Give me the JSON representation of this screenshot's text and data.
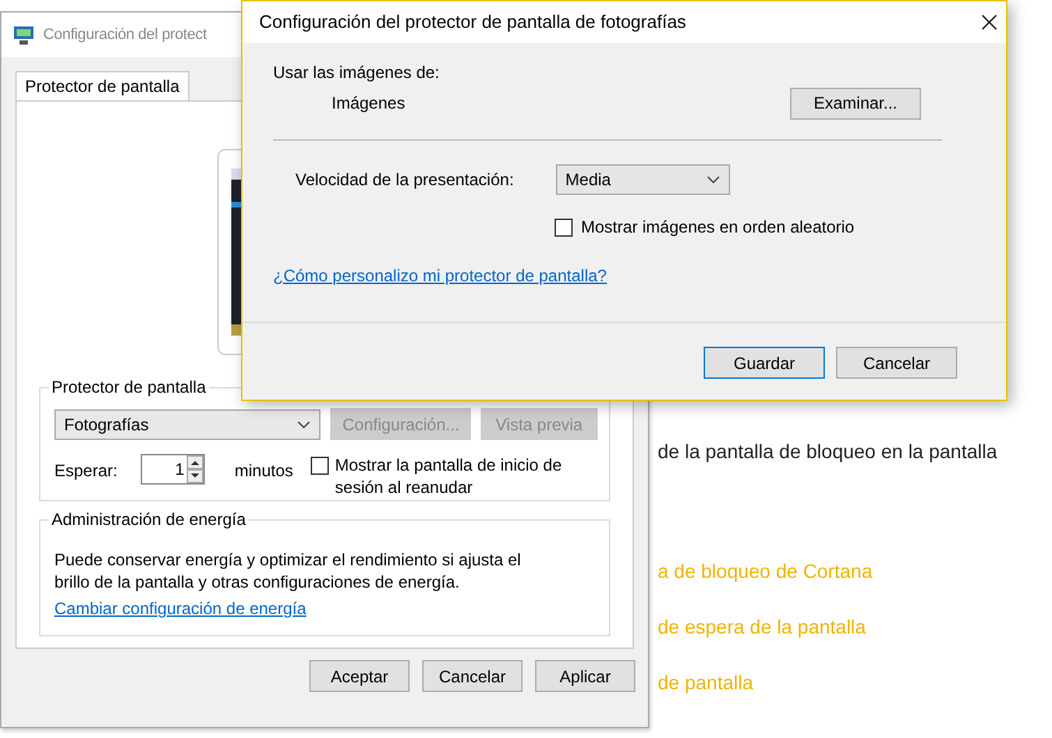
{
  "background_window": {
    "text": "de la pantalla de bloqueo en la pantalla",
    "links": [
      "a de bloqueo de Cortana",
      "de espera de la pantalla",
      "de pantalla"
    ]
  },
  "screensaver_dialog": {
    "title": "Configuración del protect",
    "tabs": [
      {
        "label": "Protector de pantalla",
        "selected": true
      }
    ],
    "screensaver_group": {
      "title": "Protector de pantalla",
      "dropdown": {
        "value": "Fotografías"
      },
      "buttons": [
        {
          "label": "Configuración...",
          "disabled": true
        },
        {
          "label": "Vista previa",
          "disabled": true
        }
      ],
      "wait_label": "Esperar:",
      "wait_value": "1",
      "wait_unit": "minutos",
      "logon_checkbox": {
        "label": "Mostrar la pantalla de inicio de sesión al reanudar",
        "checked": false
      }
    },
    "power_group": {
      "title": "Administración de energía",
      "text": "Puede conservar energía y optimizar el rendimiento si ajusta el brillo de la pantalla y otras configuraciones de energía.",
      "link": "Cambiar configuración de energía"
    },
    "buttons": [
      "Aceptar",
      "Cancelar",
      "Aplicar"
    ]
  },
  "photos_dialog": {
    "title": "Configuración del protector de pantalla de fotografías",
    "source_label": "Usar las imágenes de:",
    "source_value": "Imágenes",
    "browse_button": "Examinar...",
    "speed_label": "Velocidad de la presentación:",
    "speed_dropdown": {
      "value": "Media"
    },
    "shuffle_checkbox": {
      "label": "Mostrar imágenes en orden aleatorio",
      "checked": false
    },
    "help_link": "¿Cómo personalizo mi protector de pantalla?",
    "buttons": [
      "Guardar",
      "Cancelar"
    ]
  }
}
